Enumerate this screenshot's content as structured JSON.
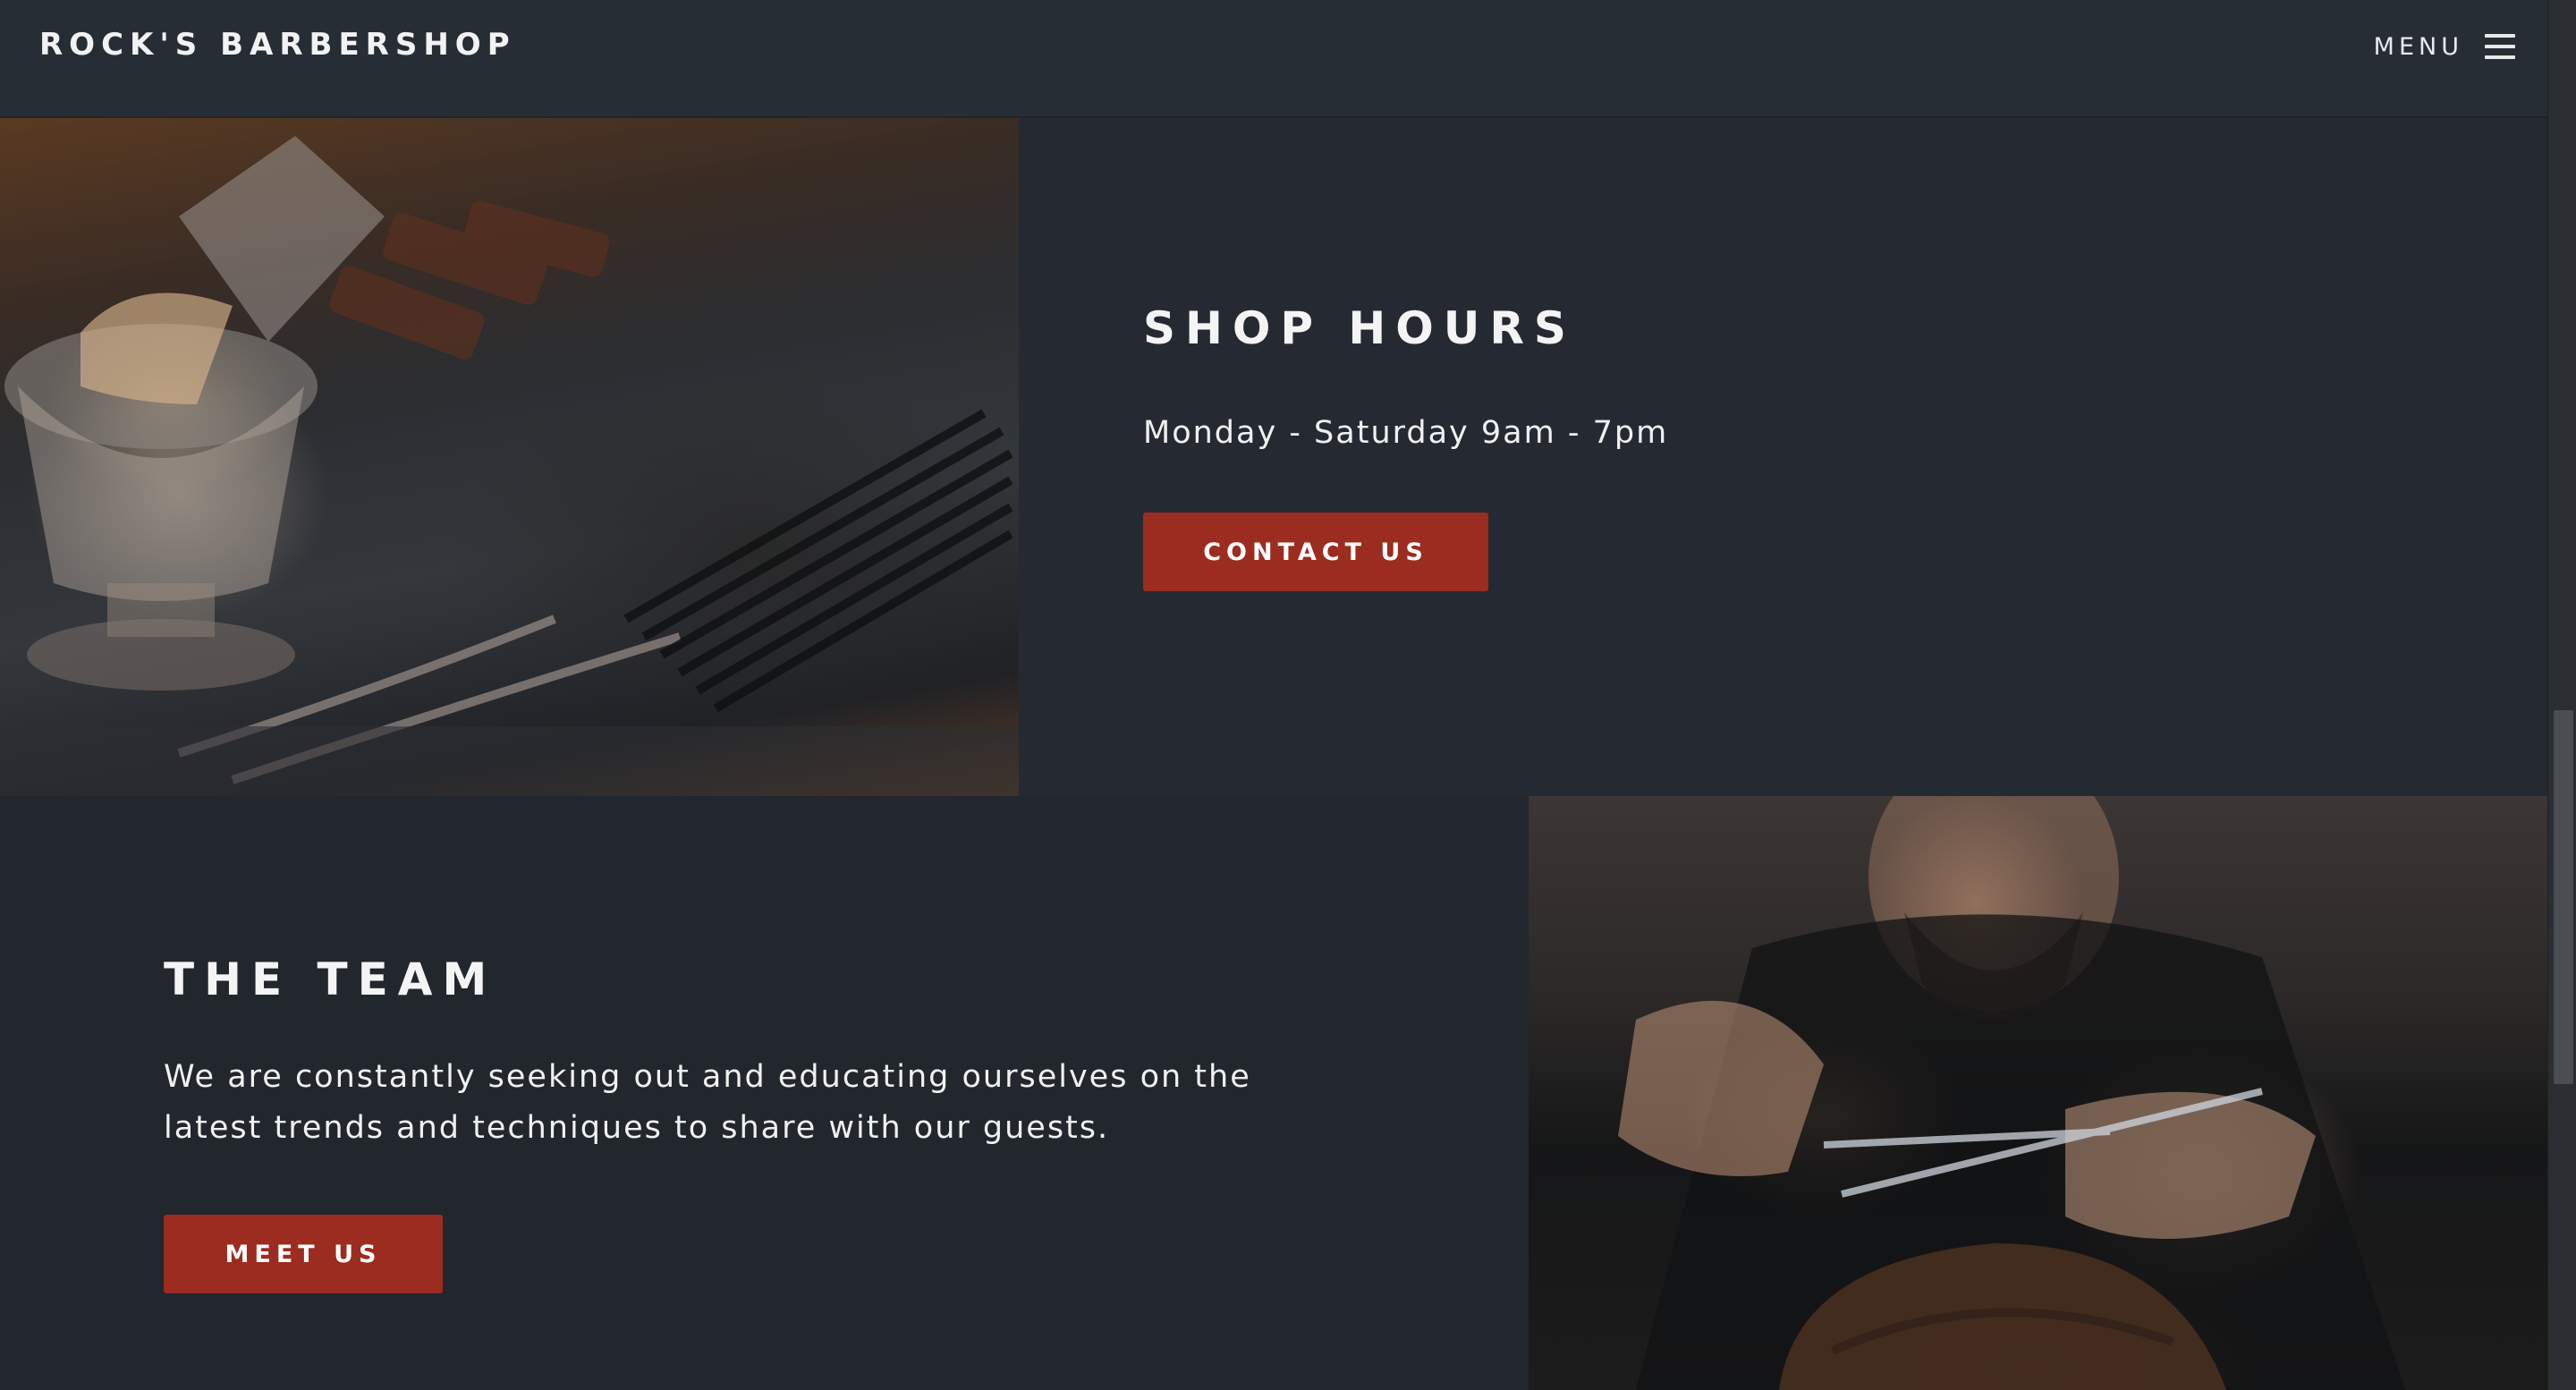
{
  "navbar": {
    "brand": "ROCK'S BARBERSHOP",
    "menu_label": "MENU"
  },
  "hours": {
    "heading": "SHOP HOURS",
    "text": "Monday - Saturday 9am - 7pm",
    "button_label": "CONTACT US"
  },
  "team": {
    "heading": "THE TEAM",
    "text": "We are constantly seeking out and educating ourselves on the latest trends and techniques to share with our guests.",
    "button_label": "MEET US"
  },
  "colors": {
    "background": "#23272e",
    "navbar": "#272d35",
    "accent": "#9c2c20",
    "text": "#ffffff"
  },
  "icons": {
    "menu": "hamburger-icon"
  }
}
